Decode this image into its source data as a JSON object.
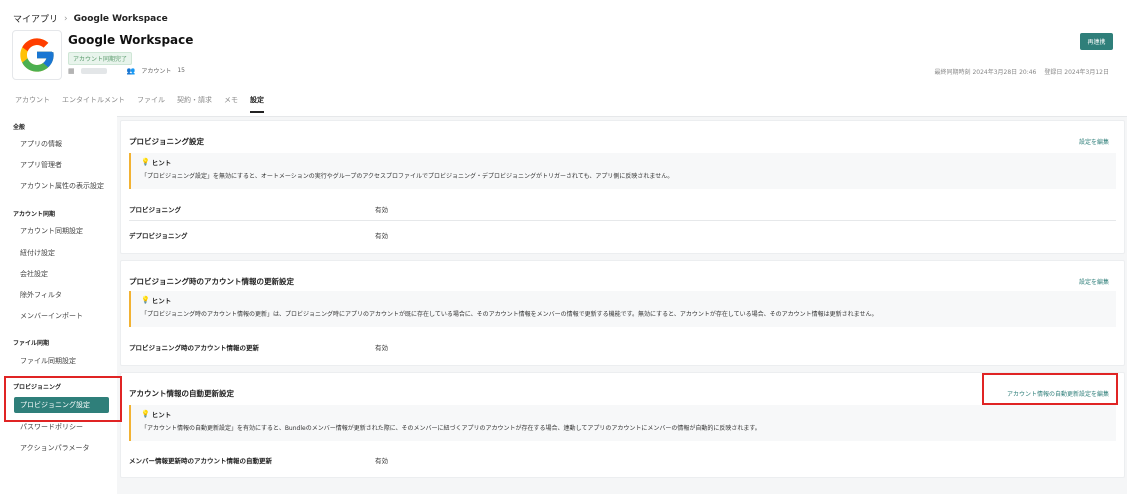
{
  "breadcrumb": {
    "root": "マイアプリ",
    "sep": "›",
    "current": "Google Workspace"
  },
  "app": {
    "title": "Google Workspace",
    "status": "アカウント同期完了",
    "account_label": "アカウント",
    "account_count": "15",
    "reconnect_label": "再連携",
    "last_sync": "最終同期時刻 2024年3月28日 20:46",
    "registered": "登録日 2024年3月12日"
  },
  "tabs": [
    {
      "label": "アカウント"
    },
    {
      "label": "エンタイトルメント"
    },
    {
      "label": "ファイル"
    },
    {
      "label": "契約・請求"
    },
    {
      "label": "メモ"
    },
    {
      "label": "設定"
    }
  ],
  "sidebar": {
    "group_general": "全般",
    "items_general": [
      "アプリの情報",
      "アプリ管理者",
      "アカウント属性の表示設定"
    ],
    "group_account_sync": "アカウント同期",
    "items_account_sync": [
      "アカウント同期設定",
      "紐付け設定",
      "会社設定",
      "除外フィルタ",
      "メンバーインポート"
    ],
    "group_file_sync": "ファイル同期",
    "items_file_sync": [
      "ファイル同期設定"
    ],
    "group_provisioning": "プロビジョニング",
    "items_provisioning": [
      "プロビジョニング設定",
      "パスワードポリシー",
      "アクションパラメータ"
    ]
  },
  "cards": {
    "provisioning": {
      "title": "プロビジョニング設定",
      "edit": "設定を編集",
      "hint_head": "ヒント",
      "hint_text": "「プロビジョニング設定」を無効にすると、オートメーションの実行やグループのアクセスプロファイルでプロビジョニング・デプロビジョニングがトリガーされても、アプリ側に反映されません。",
      "rows": [
        {
          "label": "プロビジョニング",
          "value": "有効"
        },
        {
          "label": "デプロビジョニング",
          "value": "有効"
        }
      ]
    },
    "update": {
      "title": "プロビジョニング時のアカウント情報の更新設定",
      "edit": "設定を編集",
      "hint_head": "ヒント",
      "hint_text": "「プロビジョニング時のアカウント情報の更新」は、プロビジョニング時にアプリのアカウントが既に存在している場合に、そのアカウント情報をメンバーの情報で更新する機能です。無効にすると、アカウントが存在している場合、そのアカウント情報は更新されません。",
      "rows": [
        {
          "label": "プロビジョニング時のアカウント情報の更新",
          "value": "有効"
        }
      ]
    },
    "auto": {
      "title": "アカウント情報の自動更新設定",
      "edit": "アカウント情報の自動更新設定を編集",
      "hint_head": "ヒント",
      "hint_text": "「アカウント情報の自動更新設定」を有効にすると、Bundleのメンバー情報が更新された際に、そのメンバーに紐づくアプリのアカウントが存在する場合、連動してアプリのアカウントにメンバーの情報が自動的に反映されます。",
      "rows": [
        {
          "label": "メンバー情報更新時のアカウント情報の自動更新",
          "value": "有効"
        }
      ]
    }
  },
  "colors": {
    "accent": "#2f7f7a",
    "highlight": "#e02424",
    "hint_border": "#f2b233"
  }
}
